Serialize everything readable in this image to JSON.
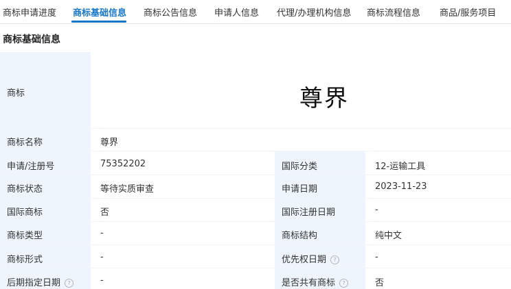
{
  "tabs": [
    {
      "label": "商标申请进度"
    },
    {
      "label": "商标基础信息"
    },
    {
      "label": "商标公告信息"
    },
    {
      "label": "申请人信息"
    },
    {
      "label": "代理/办理机构信息"
    },
    {
      "label": "商标流程信息"
    },
    {
      "label": "商品/服务项目"
    }
  ],
  "section_title": "商标基础信息",
  "trademark": {
    "label": "商标",
    "mark_text": "尊界"
  },
  "name_row": {
    "label": "商标名称",
    "value": "尊界"
  },
  "rows": [
    {
      "left_label": "申请/注册号",
      "left_value": "75352202",
      "right_label": "国际分类",
      "right_value": "12-运输工具"
    },
    {
      "left_label": "商标状态",
      "left_value": "等待实质审查",
      "right_label": "申请日期",
      "right_value": "2023-11-23"
    },
    {
      "left_label": "国际商标",
      "left_value": "否",
      "right_label": "国际注册日期",
      "right_value": "-"
    },
    {
      "left_label": "商标类型",
      "left_value": "-",
      "right_label": "商标结构",
      "right_value": "纯中文"
    },
    {
      "left_label": "商标形式",
      "left_value": "-",
      "right_label": "优先权日期",
      "right_value": "-"
    },
    {
      "left_label": "后期指定日期",
      "left_value": "-",
      "right_label": "是否共有商标",
      "right_value": "否"
    }
  ],
  "help_glyph": "?",
  "colors": {
    "accent": "#1677c9",
    "label_bg": "#eef5fc"
  }
}
